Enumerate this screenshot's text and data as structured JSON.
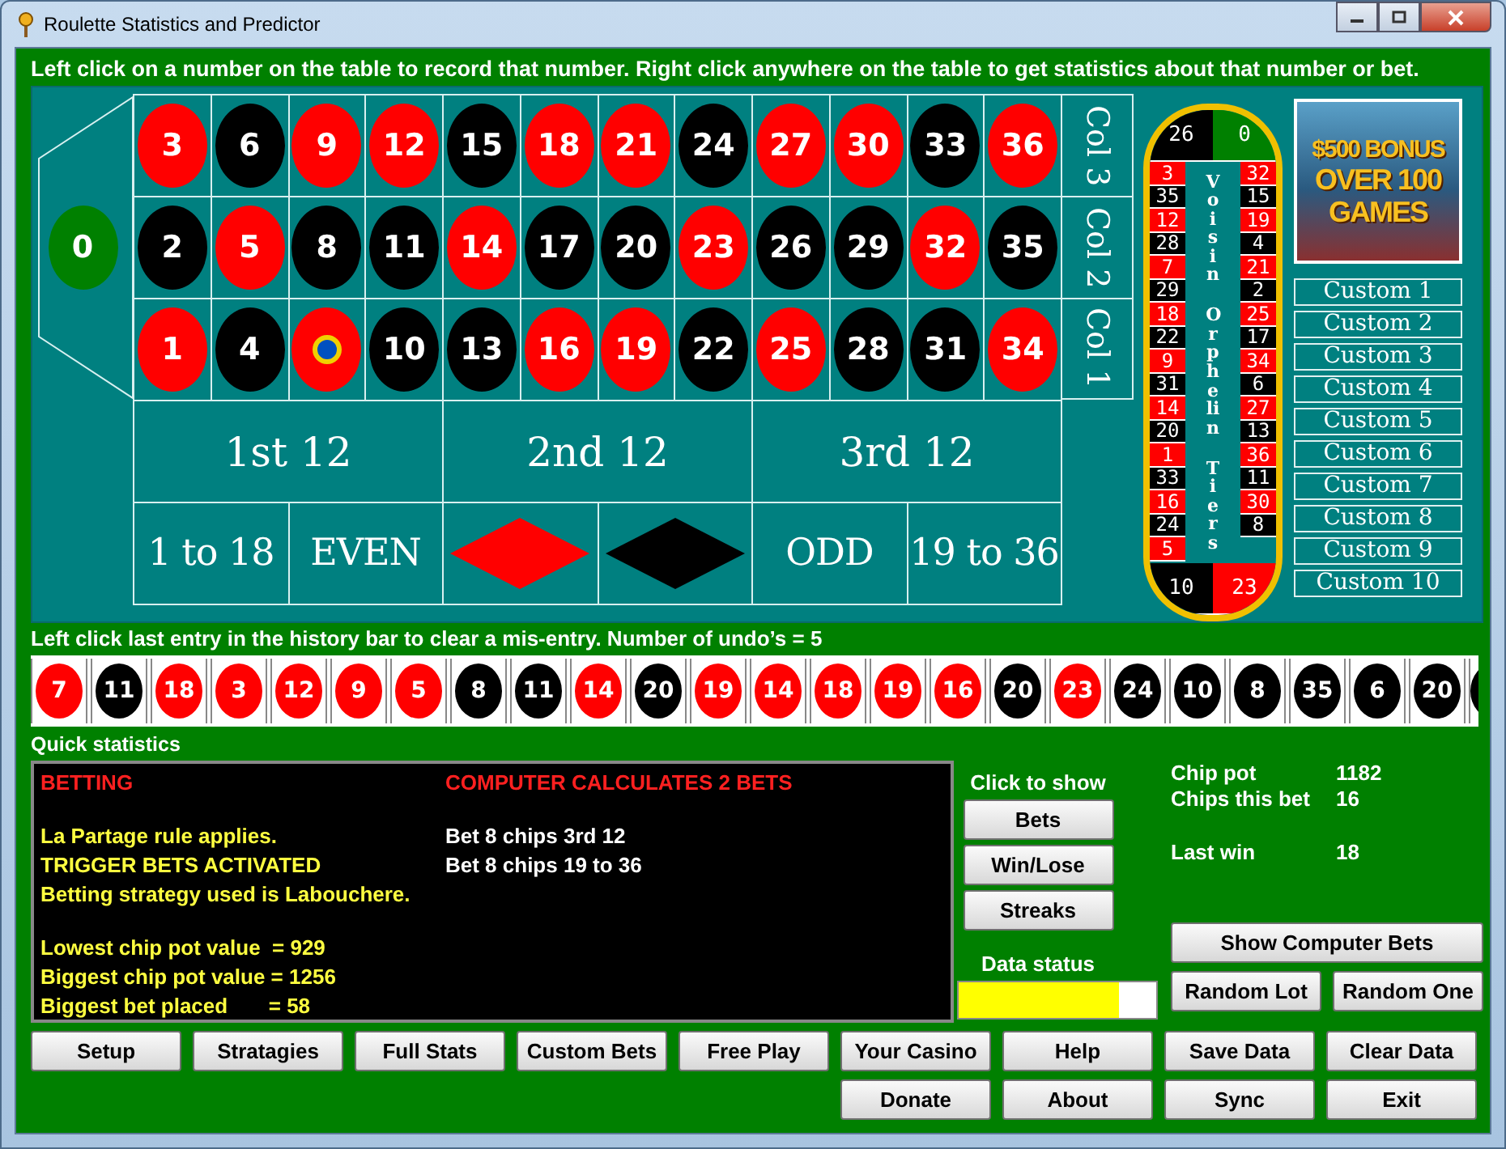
{
  "window": {
    "title": "Roulette Statistics and Predictor"
  },
  "instruction": "Left click on a number on the table to record that number. Right click anywhere on the table to get statistics about that number or bet.",
  "table": {
    "zero": {
      "number": "0",
      "color": "#008000"
    },
    "rows": [
      [
        {
          "kind": "number",
          "number": "3",
          "color": "#ff0000"
        },
        {
          "kind": "number",
          "number": "6",
          "color": "#000000"
        },
        {
          "kind": "number",
          "number": "9",
          "color": "#ff0000"
        },
        {
          "kind": "number",
          "number": "12",
          "color": "#ff0000"
        },
        {
          "kind": "number",
          "number": "15",
          "color": "#000000"
        },
        {
          "kind": "number",
          "number": "18",
          "color": "#ff0000"
        },
        {
          "kind": "number",
          "number": "21",
          "color": "#ff0000"
        },
        {
          "kind": "number",
          "number": "24",
          "color": "#000000"
        },
        {
          "kind": "number",
          "number": "27",
          "color": "#ff0000"
        },
        {
          "kind": "number",
          "number": "30",
          "color": "#ff0000"
        },
        {
          "kind": "number",
          "number": "33",
          "color": "#000000"
        },
        {
          "kind": "number",
          "number": "36",
          "color": "#ff0000"
        }
      ],
      [
        {
          "kind": "number",
          "number": "2",
          "color": "#000000"
        },
        {
          "kind": "number",
          "number": "5",
          "color": "#ff0000"
        },
        {
          "kind": "number",
          "number": "8",
          "color": "#000000"
        },
        {
          "kind": "number",
          "number": "11",
          "color": "#000000"
        },
        {
          "kind": "number",
          "number": "14",
          "color": "#ff0000"
        },
        {
          "kind": "number",
          "number": "17",
          "color": "#000000"
        },
        {
          "kind": "number",
          "number": "20",
          "color": "#000000"
        },
        {
          "kind": "number",
          "number": "23",
          "color": "#ff0000"
        },
        {
          "kind": "number",
          "number": "26",
          "color": "#000000"
        },
        {
          "kind": "number",
          "number": "29",
          "color": "#000000"
        },
        {
          "kind": "number",
          "number": "32",
          "color": "#ff0000"
        },
        {
          "kind": "number",
          "number": "35",
          "color": "#000000"
        }
      ],
      [
        {
          "kind": "number",
          "number": "1",
          "color": "#ff0000"
        },
        {
          "kind": "number",
          "number": "4",
          "color": "#000000"
        },
        {
          "kind": "chip",
          "color": "#ff0000"
        },
        {
          "kind": "number",
          "number": "10",
          "color": "#000000"
        },
        {
          "kind": "number",
          "number": "13",
          "color": "#000000"
        },
        {
          "kind": "number",
          "number": "16",
          "color": "#ff0000"
        },
        {
          "kind": "number",
          "number": "19",
          "color": "#ff0000"
        },
        {
          "kind": "number",
          "number": "22",
          "color": "#000000"
        },
        {
          "kind": "number",
          "number": "25",
          "color": "#ff0000"
        },
        {
          "kind": "number",
          "number": "28",
          "color": "#000000"
        },
        {
          "kind": "number",
          "number": "31",
          "color": "#000000"
        },
        {
          "kind": "number",
          "number": "34",
          "color": "#ff0000"
        }
      ]
    ],
    "column_labels": [
      "Col 3",
      "Col 2",
      "Col 1"
    ],
    "dozens": [
      "1st 12",
      "2nd 12",
      "3rd 12"
    ],
    "outside": [
      {
        "kind": "text",
        "label": "1 to 18"
      },
      {
        "kind": "text",
        "label": "EVEN"
      },
      {
        "kind": "diamond",
        "color": "#ff0000"
      },
      {
        "kind": "diamond",
        "color": "#000000"
      },
      {
        "kind": "text",
        "label": "ODD"
      },
      {
        "kind": "text",
        "label": "19 to 36"
      }
    ]
  },
  "wheel": {
    "top": [
      {
        "number": "26",
        "color": "#000000"
      },
      {
        "number": "0",
        "color": "#008000"
      }
    ],
    "left": [
      {
        "number": "3",
        "color": "#ff0000"
      },
      {
        "number": "35",
        "color": "#000000"
      },
      {
        "number": "12",
        "color": "#ff0000"
      },
      {
        "number": "28",
        "color": "#000000"
      },
      {
        "number": "7",
        "color": "#ff0000"
      },
      {
        "number": "29",
        "color": "#000000"
      },
      {
        "number": "18",
        "color": "#ff0000"
      },
      {
        "number": "22",
        "color": "#000000"
      },
      {
        "number": "9",
        "color": "#ff0000"
      },
      {
        "number": "31",
        "color": "#000000"
      },
      {
        "number": "14",
        "color": "#ff0000"
      },
      {
        "number": "20",
        "color": "#000000"
      },
      {
        "number": "1",
        "color": "#ff0000"
      },
      {
        "number": "33",
        "color": "#000000"
      },
      {
        "number": "16",
        "color": "#ff0000"
      },
      {
        "number": "24",
        "color": "#000000"
      },
      {
        "number": "5",
        "color": "#ff0000"
      }
    ],
    "right": [
      {
        "number": "32",
        "color": "#ff0000"
      },
      {
        "number": "15",
        "color": "#000000"
      },
      {
        "number": "19",
        "color": "#ff0000"
      },
      {
        "number": "4",
        "color": "#000000"
      },
      {
        "number": "21",
        "color": "#ff0000"
      },
      {
        "number": "2",
        "color": "#000000"
      },
      {
        "number": "25",
        "color": "#ff0000"
      },
      {
        "number": "17",
        "color": "#000000"
      },
      {
        "number": "34",
        "color": "#ff0000"
      },
      {
        "number": "6",
        "color": "#000000"
      },
      {
        "number": "27",
        "color": "#ff0000"
      },
      {
        "number": "13",
        "color": "#000000"
      },
      {
        "number": "36",
        "color": "#ff0000"
      },
      {
        "number": "11",
        "color": "#000000"
      },
      {
        "number": "30",
        "color": "#ff0000"
      },
      {
        "number": "8",
        "color": "#000000"
      }
    ],
    "bottom": [
      {
        "number": "10",
        "color": "#000000"
      },
      {
        "number": "23",
        "color": "#ff0000"
      }
    ],
    "sections": [
      "Voisin",
      "Orphelin",
      "Tiers"
    ]
  },
  "ad": {
    "lines": [
      "$500 BONUS",
      "OVER 100",
      "GAMES"
    ]
  },
  "custom_buttons": [
    "Custom 1",
    "Custom 2",
    "Custom 3",
    "Custom 4",
    "Custom 5",
    "Custom 6",
    "Custom 7",
    "Custom 8",
    "Custom 9",
    "Custom 10"
  ],
  "history": {
    "hint": "Left click last entry in the history bar to clear a mis-entry. Number of undo’s = 5",
    "entries": [
      {
        "number": "7",
        "color": "#ff0000"
      },
      {
        "number": "11",
        "color": "#000000"
      },
      {
        "number": "18",
        "color": "#ff0000"
      },
      {
        "number": "3",
        "color": "#ff0000"
      },
      {
        "number": "12",
        "color": "#ff0000"
      },
      {
        "number": "9",
        "color": "#ff0000"
      },
      {
        "number": "5",
        "color": "#ff0000"
      },
      {
        "number": "8",
        "color": "#000000"
      },
      {
        "number": "11",
        "color": "#000000"
      },
      {
        "number": "14",
        "color": "#ff0000"
      },
      {
        "number": "20",
        "color": "#000000"
      },
      {
        "number": "19",
        "color": "#ff0000"
      },
      {
        "number": "14",
        "color": "#ff0000"
      },
      {
        "number": "18",
        "color": "#ff0000"
      },
      {
        "number": "19",
        "color": "#ff0000"
      },
      {
        "number": "16",
        "color": "#ff0000"
      },
      {
        "number": "20",
        "color": "#000000"
      },
      {
        "number": "23",
        "color": "#ff0000"
      },
      {
        "number": "24",
        "color": "#000000"
      },
      {
        "number": "10",
        "color": "#000000"
      },
      {
        "number": "8",
        "color": "#000000"
      },
      {
        "number": "35",
        "color": "#000000"
      },
      {
        "number": "6",
        "color": "#000000"
      },
      {
        "number": "20",
        "color": "#000000"
      }
    ]
  },
  "quick_stats": {
    "title": "Quick statistics",
    "left": [
      [
        {
          "text": "BETTING",
          "color": "#ff2020"
        }
      ],
      [
        {
          "text": "La Partage rule applies.",
          "color": "#ffff40"
        },
        {
          "text": "TRIGGER BETS ACTIVATED",
          "color": "#ffff40"
        },
        {
          "text": "Betting strategy used is Labouchere.",
          "color": "#ffff40"
        }
      ],
      [
        {
          "text": "Lowest chip pot value  = 929",
          "color": "#ffff40"
        },
        {
          "text": "Biggest chip pot value = 1256",
          "color": "#ffff40"
        },
        {
          "text": "Biggest bet placed       = 58",
          "color": "#ffff40"
        }
      ]
    ],
    "right": [
      [
        {
          "text": "COMPUTER CALCULATES 2 BETS",
          "color": "#ff2020"
        }
      ],
      [
        {
          "text": "Bet 8 chips 3rd 12",
          "color": "#ffffff"
        },
        {
          "text": "Bet 8 chips 19 to 36",
          "color": "#ffffff"
        }
      ]
    ]
  },
  "show_panel": {
    "label": "Click to show",
    "buttons": [
      "Bets",
      "Win/Lose",
      "Streaks"
    ]
  },
  "chips": [
    [
      {
        "label": "Chip pot",
        "value": "1182"
      },
      {
        "label": "Chips this bet",
        "value": "16"
      }
    ],
    [
      {
        "label": "Last win",
        "value": "18"
      }
    ]
  ],
  "data_status": {
    "label": "Data status",
    "level": 0.81
  },
  "side_buttons": [
    "Show Computer Bets",
    "Random Lot",
    "Random One"
  ],
  "button_rows": [
    [
      "Setup",
      "Stratagies",
      "Full Stats",
      "Custom Bets",
      "Free Play",
      "Your Casino",
      "Help",
      "Save Data",
      "Clear Data"
    ],
    [
      "Donate",
      "About",
      "Sync",
      "Exit"
    ]
  ]
}
